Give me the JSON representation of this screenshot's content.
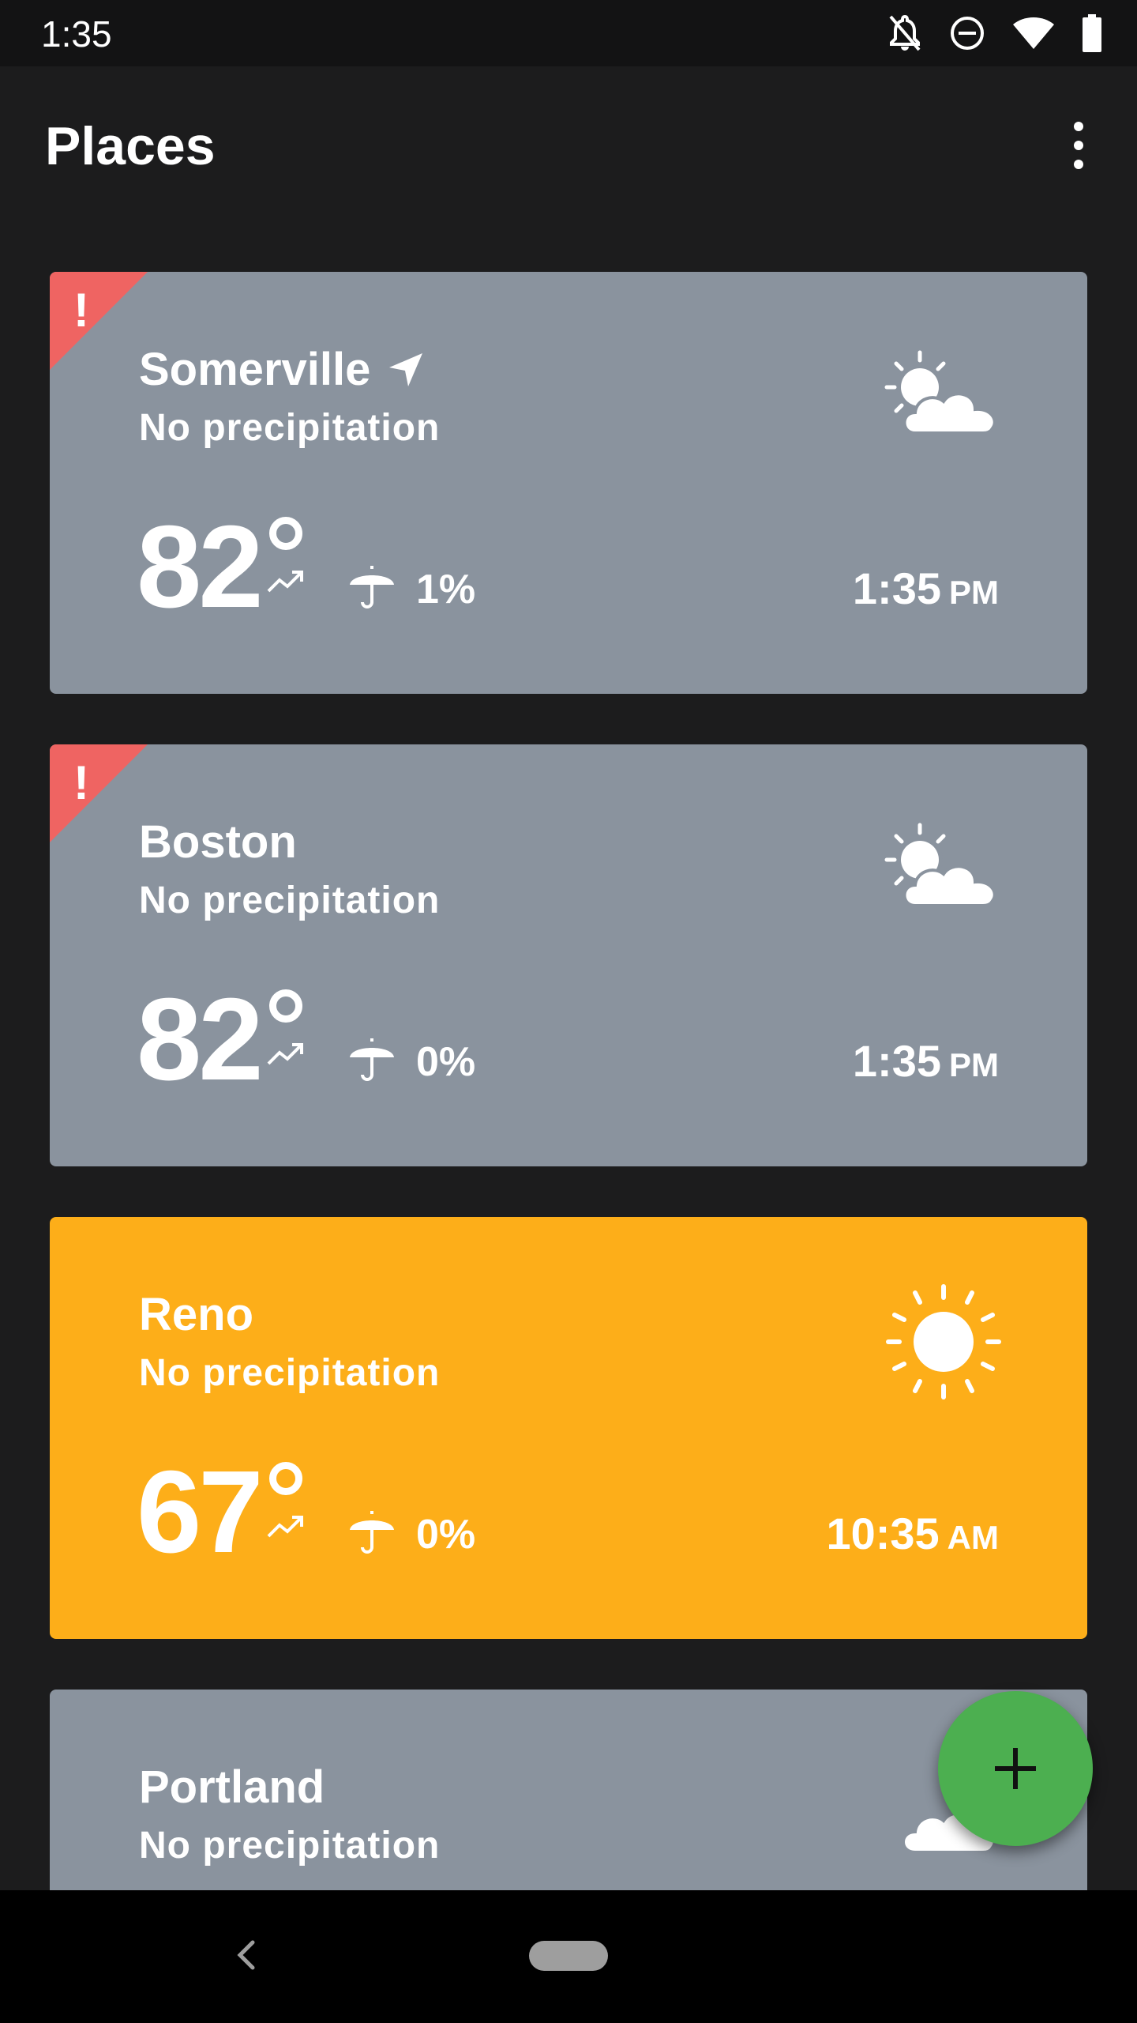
{
  "status_bar": {
    "time": "1:35",
    "icons": [
      "notifications-off-icon",
      "do-not-disturb-icon",
      "wifi-icon",
      "battery-icon"
    ]
  },
  "app_bar": {
    "title": "Places",
    "menu_icon": "more-vert-icon"
  },
  "colors": {
    "cloudy_card": "#8a939e",
    "sunny_card": "#fdae19",
    "alert": "#ef6462",
    "fab": "#4caf50",
    "background": "#1c1c1d"
  },
  "places": [
    {
      "name": "Somerville",
      "current_location": true,
      "alert": true,
      "alert_mark": "!",
      "precipitation": "No precipitation",
      "temperature": "82",
      "trend_icon": "trending-up-icon",
      "precip_chance": "1%",
      "time": "1:35",
      "ampm": "PM",
      "weather_icon": "partly-cloudy-icon",
      "color": "#8a939e"
    },
    {
      "name": "Boston",
      "current_location": false,
      "alert": true,
      "alert_mark": "!",
      "precipitation": "No precipitation",
      "temperature": "82",
      "trend_icon": "trending-up-icon",
      "precip_chance": "0%",
      "time": "1:35",
      "ampm": "PM",
      "weather_icon": "partly-cloudy-icon",
      "color": "#8a939e"
    },
    {
      "name": "Reno",
      "current_location": false,
      "alert": false,
      "precipitation": "No precipitation",
      "temperature": "67",
      "trend_icon": "trending-up-icon",
      "precip_chance": "0%",
      "time": "10:35",
      "ampm": "AM",
      "weather_icon": "sunny-icon",
      "color": "#fdae19"
    },
    {
      "name": "Portland",
      "current_location": false,
      "alert": false,
      "precipitation": "No precipitation",
      "weather_icon": "cloudy-icon",
      "color": "#8a939e"
    }
  ],
  "fab": {
    "icon": "add-icon"
  },
  "nav_bar": {
    "back_icon": "back-icon",
    "home_icon": "home-pill-icon"
  }
}
